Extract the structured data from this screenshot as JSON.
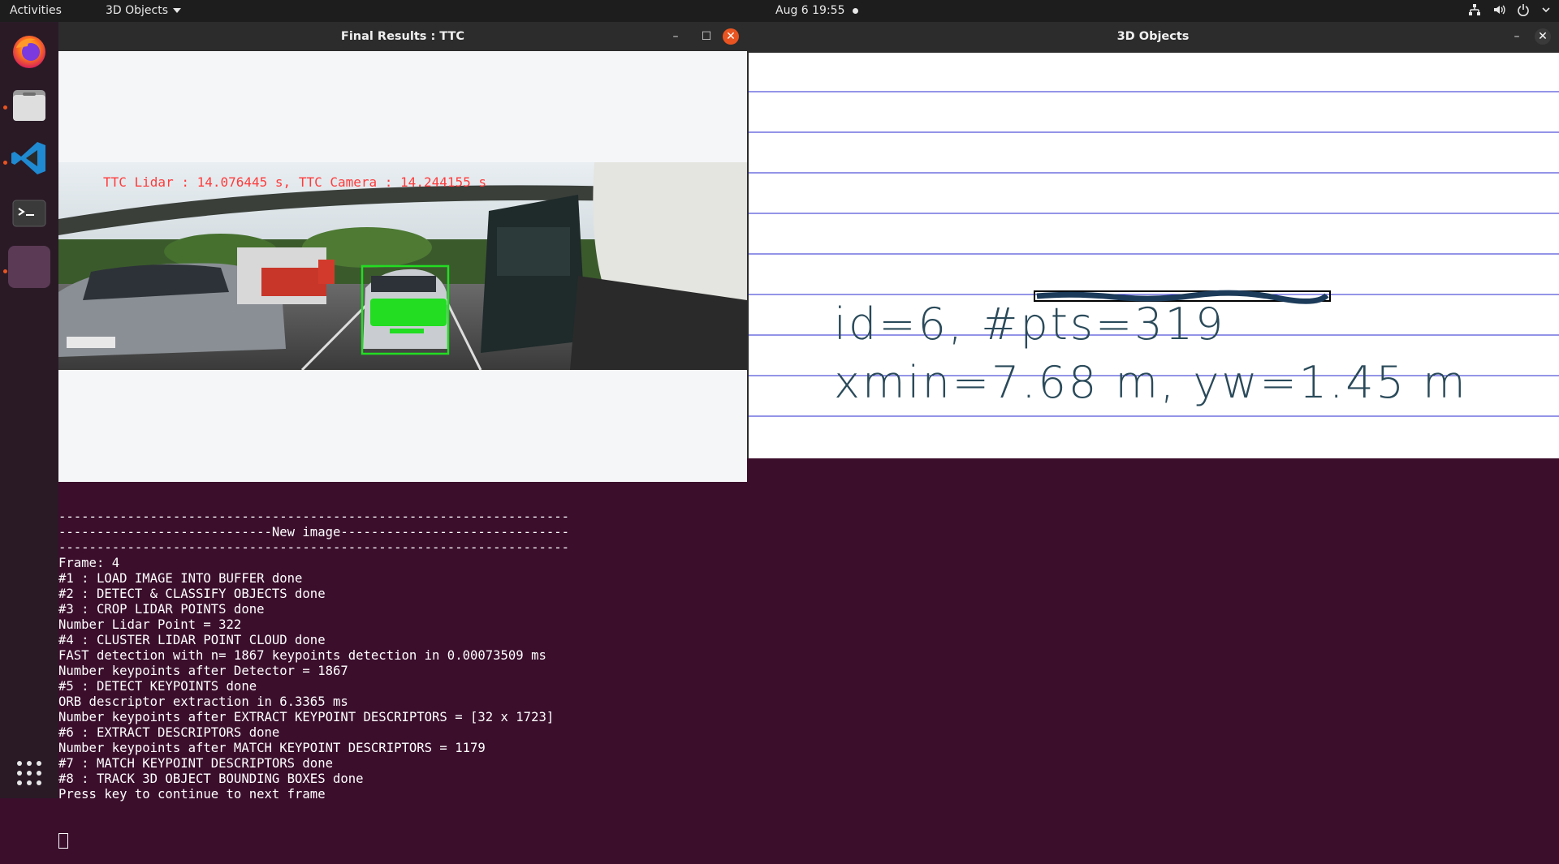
{
  "topbar": {
    "activities": "Activities",
    "app_menu": "3D Objects",
    "clock": "Aug 6  19:55"
  },
  "dock": {
    "items": [
      "firefox-icon",
      "files-icon",
      "vscode-icon",
      "terminal-icon",
      "active-window-icon",
      "show-apps-icon"
    ]
  },
  "windows": {
    "ttc": {
      "title": "Final Results : TTC",
      "overlay_text": "TTC Lidar : 14.076445 s, TTC Camera : 14.244155 s"
    },
    "objects": {
      "title": "3D Objects",
      "label_line1": "id=6, #pts=319",
      "label_line2": "xmin=7.68 m, yw=1.45 m"
    }
  },
  "terminal": {
    "lines": [
      "-------------------------------------------------------------------",
      "----------------------------New image------------------------------",
      "-------------------------------------------------------------------",
      "Frame: 4",
      "#1 : LOAD IMAGE INTO BUFFER done",
      "#2 : DETECT & CLASSIFY OBJECTS done",
      "#3 : CROP LIDAR POINTS done",
      "Number Lidar Point = 322",
      "#4 : CLUSTER LIDAR POINT CLOUD done",
      "FAST detection with n= 1867 keypoints detection in 0.00073509 ms",
      "Number keypoints after Detector = 1867",
      "#5 : DETECT KEYPOINTS done",
      "ORB descriptor extraction in 6.3365 ms",
      "Number keypoints after EXTRACT KEYPOINT DESCRIPTORS = [32 x 1723]",
      "#6 : EXTRACT DESCRIPTORS done",
      "Number keypoints after MATCH KEYPOINT DESCRIPTORS = 1179",
      "#7 : MATCH KEYPOINT DESCRIPTORS done",
      "#8 : TRACK 3D OBJECT BOUNDING BOXES done",
      "Press key to continue to next frame"
    ]
  },
  "colors": {
    "topbar_bg": "#1d1d1d",
    "terminal_bg": "#3b0e2c",
    "accent": "#e95420",
    "bbox_green": "#22dd22",
    "overlay_red": "#ff3b3b",
    "grid_blue": "#2a2ad0"
  }
}
